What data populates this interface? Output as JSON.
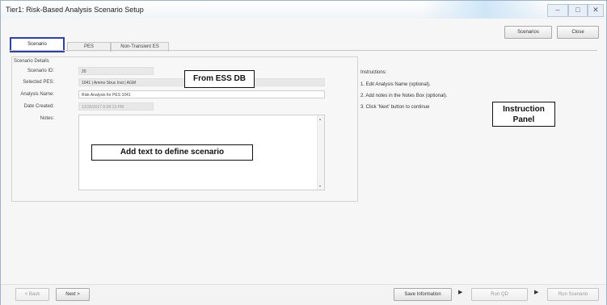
{
  "window": {
    "title": "Tier1: Risk-Based Analysis Scenario Setup",
    "controls": {
      "minimize": "–",
      "maximize": "□",
      "close": "✕"
    }
  },
  "toolbar": {
    "scenarios_label": "Scenarios",
    "close_label": "Close"
  },
  "tabs": [
    {
      "label": "Scenario",
      "active": true
    },
    {
      "label": "PES",
      "active": false
    },
    {
      "label": "Non-Transient ES",
      "active": false
    }
  ],
  "scenario_details": {
    "group_title": "Scenario Details",
    "scenario_id": {
      "label": "Scenario ID:",
      "value": "20"
    },
    "selected_pes": {
      "label": "Selected PES:",
      "value": "1041 | Ammo Struc Inst | AGM"
    },
    "analysis_name": {
      "label": "Analysis Name:",
      "value": "Risk Analysis for PES 1041"
    },
    "date_created": {
      "label": "Date Created:",
      "value": "12/26/2017 6:06:13 PM"
    },
    "notes": {
      "label": "Notes:",
      "value": ""
    }
  },
  "callouts": {
    "ess_db": "From ESS DB",
    "define": "Add text to define scenario",
    "panel_line1": "Instruction",
    "panel_line2": "Panel"
  },
  "instructions": {
    "heading": "Instructions:",
    "steps": [
      "1. Edit Analysis Name (optional).",
      "2. Add notes in the Notes Box (optional).",
      "3. Click 'Next' button to continue"
    ]
  },
  "bottom": {
    "back_label": "< Back",
    "next_label": "Next >",
    "save_label": "Save Information",
    "run_qd_label": "Run QD",
    "run_scenario_label": "Run Scenario",
    "step_arrow": "▶"
  },
  "colors": {
    "active_tab_border": "#2b3fb8",
    "window_border": "#9fb3c8"
  }
}
